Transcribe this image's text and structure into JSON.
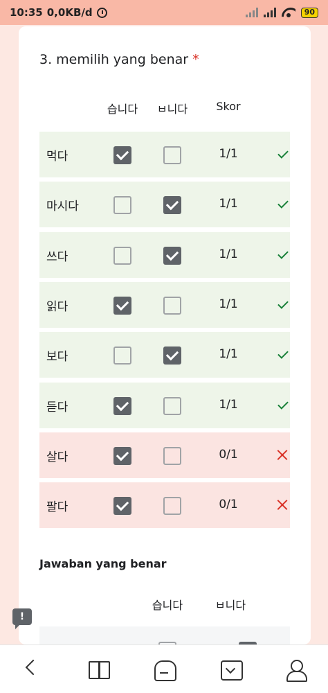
{
  "status_bar": {
    "time": "10:35",
    "speed": "0,0KB/d",
    "battery": "90"
  },
  "question": {
    "title": "3. memilih yang benar",
    "required_mark": "*",
    "columns": [
      "습니다",
      "ㅂ니다"
    ],
    "score_header": "Skor",
    "rows": [
      {
        "label": "먹다",
        "checked": [
          true,
          false
        ],
        "score": "1/1",
        "correct": true
      },
      {
        "label": "마시다",
        "checked": [
          false,
          true
        ],
        "score": "1/1",
        "correct": true
      },
      {
        "label": "쓰다",
        "checked": [
          false,
          true
        ],
        "score": "1/1",
        "correct": true
      },
      {
        "label": "읽다",
        "checked": [
          true,
          false
        ],
        "score": "1/1",
        "correct": true
      },
      {
        "label": "보다",
        "checked": [
          false,
          true
        ],
        "score": "1/1",
        "correct": true
      },
      {
        "label": "듣다",
        "checked": [
          true,
          false
        ],
        "score": "1/1",
        "correct": true
      },
      {
        "label": "살다",
        "checked": [
          true,
          false
        ],
        "score": "0/1",
        "correct": false
      },
      {
        "label": "팔다",
        "checked": [
          true,
          false
        ],
        "score": "0/1",
        "correct": false
      }
    ]
  },
  "correct_answers": {
    "title": "Jawaban yang benar",
    "columns": [
      "습니다",
      "ㅂ니다"
    ],
    "first_row_checked": [
      false,
      true
    ]
  },
  "feedback_button": "!",
  "nav": [
    "back-icon",
    "book-icon",
    "home-icon",
    "download-icon",
    "profile-icon"
  ],
  "colors": {
    "status_bar": "#f9b8a6",
    "background": "#fde8e2",
    "correct_row": "#eef5e9",
    "incorrect_row": "#fbe4e1",
    "checkbox_checked": "#5f6368",
    "check_mark": "#188038",
    "cross_mark": "#d93025"
  }
}
